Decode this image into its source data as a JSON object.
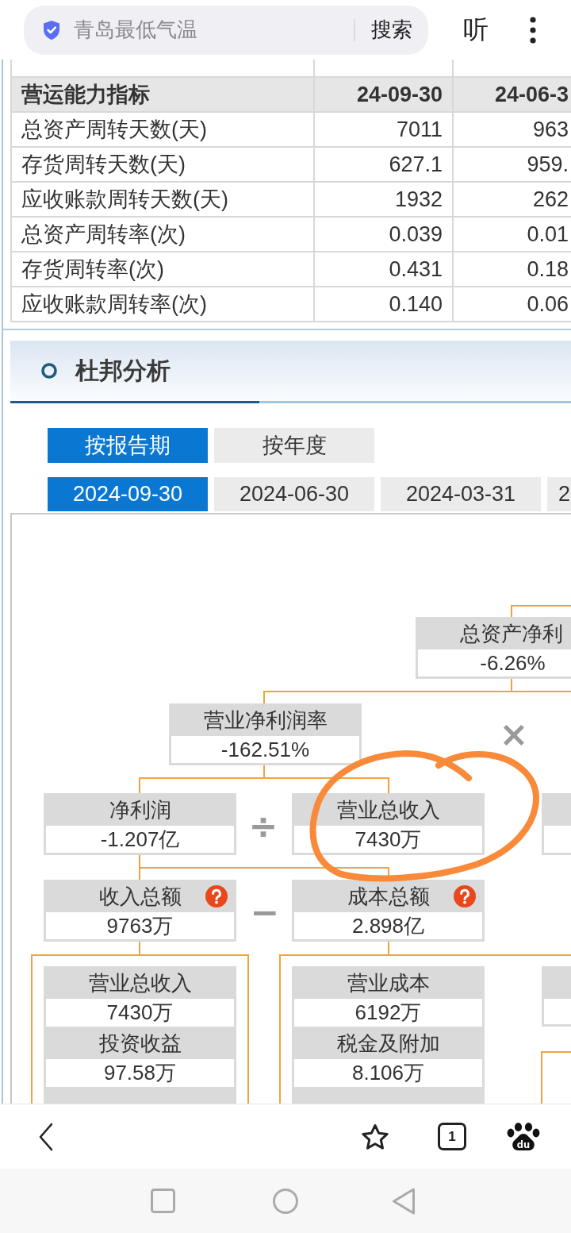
{
  "search_bar": {
    "placeholder": "青岛最低气温",
    "button": "搜索"
  },
  "listen_button": "听",
  "table": {
    "columns": [
      "营运能力指标",
      "24-09-30",
      "24-06-3"
    ],
    "rows": [
      [
        "总资产周转天数(天)",
        "7011",
        "963"
      ],
      [
        "存货周转天数(天)",
        "627.1",
        "959."
      ],
      [
        "应收账款周转天数(天)",
        "1932",
        "262"
      ],
      [
        "总资产周转率(次)",
        "0.039",
        "0.01"
      ],
      [
        "存货周转率(次)",
        "0.431",
        "0.18"
      ],
      [
        "应收账款周转率(次)",
        "0.140",
        "0.06"
      ]
    ]
  },
  "section": {
    "title": "杜邦分析"
  },
  "period_tabs": [
    {
      "label": "按报告期",
      "selected": true
    },
    {
      "label": "按年度",
      "selected": false
    }
  ],
  "date_tabs": [
    {
      "label": "2024-09-30",
      "selected": true
    },
    {
      "label": "2024-06-30",
      "selected": false
    },
    {
      "label": "2024-03-31",
      "selected": false
    },
    {
      "label": "2",
      "selected": false
    }
  ],
  "dupont": {
    "nodes": [
      {
        "label": "总资产净利",
        "value": "-6.26%",
        "help": false
      },
      {
        "label": "营业净利润率",
        "value": "-162.51%",
        "help": false
      },
      {
        "label": "净利润",
        "value": "-1.207亿",
        "help": false
      },
      {
        "label": "营业总收入",
        "value": "7430万",
        "help": false
      },
      {
        "label": "收入总额",
        "value": "9763万",
        "help": true
      },
      {
        "label": "成本总额",
        "value": "2.898亿",
        "help": true
      }
    ],
    "operators": [
      "×",
      "÷",
      "−"
    ],
    "income_items": [
      {
        "label": "营业总收入",
        "value": "7430万"
      },
      {
        "label": "投资收益",
        "value": "97.58万"
      }
    ],
    "cost_items": [
      {
        "label": "营业成本",
        "value": "6192万"
      },
      {
        "label": "税金及附加",
        "value": "8.106万"
      }
    ]
  },
  "toolbar": {
    "tab_count": "1",
    "logo_text": "du"
  }
}
